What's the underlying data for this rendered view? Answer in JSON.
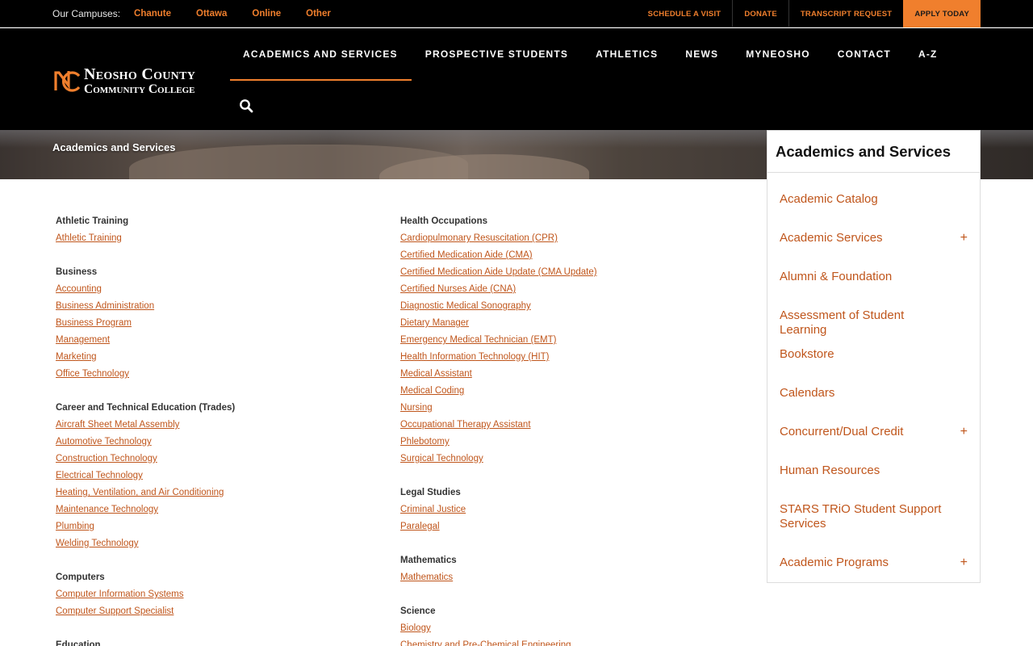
{
  "topbar": {
    "campuses_label": "Our Campuses:",
    "campuses": [
      "Chanute",
      "Ottawa",
      "Online",
      "Other"
    ],
    "utility_links": [
      "SCHEDULE A VISIT",
      "DONATE",
      "TRANSCRIPT REQUEST"
    ],
    "apply_label": "APPLY TODAY"
  },
  "logo": {
    "line1": "Neosho County",
    "line2": "Community College"
  },
  "nav": {
    "items": [
      "ACADEMICS AND SERVICES",
      "PROSPECTIVE STUDENTS",
      "ATHLETICS",
      "NEWS",
      "MYNEOSHO",
      "CONTACT",
      "A-Z"
    ],
    "active_index": 0,
    "search_icon": "search-icon"
  },
  "hero": {
    "title": "Academics and Services"
  },
  "columns": [
    [
      {
        "heading": "Athletic Training",
        "links": [
          "Athletic Training"
        ]
      },
      {
        "heading": "Business",
        "links": [
          "Accounting",
          "Business Administration",
          "Business Program",
          "Management",
          "Marketing",
          "Office Technology"
        ]
      },
      {
        "heading": "Career and Technical Education (Trades)",
        "links": [
          "Aircraft Sheet Metal Assembly",
          "Automotive Technology",
          "Construction Technology",
          "Electrical Technology",
          "Heating, Ventilation, and Air Conditioning",
          "Maintenance Technology",
          "Plumbing",
          "Welding Technology"
        ]
      },
      {
        "heading": "Computers",
        "links": [
          "Computer Information Systems",
          "Computer Support Specialist"
        ]
      },
      {
        "heading": "Education",
        "links": []
      }
    ],
    [
      {
        "heading": "Health Occupations",
        "links": [
          "Cardiopulmonary Resuscitation (CPR)",
          "Certified Medication Aide (CMA)",
          "Certified Medication Aide Update (CMA Update)",
          "Certified Nurses Aide (CNA)",
          "Diagnostic Medical Sonography",
          "Dietary Manager",
          "Emergency Medical Technician (EMT)",
          "Health Information Technology (HIT)",
          "Medical Assistant",
          "Medical Coding",
          "Nursing",
          "Occupational Therapy Assistant",
          "Phlebotomy",
          "Surgical Technology"
        ]
      },
      {
        "heading": "Legal Studies",
        "links": [
          "Criminal Justice",
          "Paralegal"
        ]
      },
      {
        "heading": "Mathematics",
        "links": [
          "Mathematics"
        ]
      },
      {
        "heading": "Science",
        "links": [
          "Biology",
          "Chemistry and Pre-Chemical Engineering"
        ]
      }
    ]
  ],
  "sidebar": {
    "title": "Academics and Services",
    "items": [
      {
        "label": "Academic Catalog",
        "expandable": false
      },
      {
        "label": "Academic Services",
        "expandable": true
      },
      {
        "label": "Alumni & Foundation",
        "expandable": false
      },
      {
        "label": "Assessment of Student Learning",
        "expandable": false
      },
      {
        "label": "Bookstore",
        "expandable": false
      },
      {
        "label": "Calendars",
        "expandable": false
      },
      {
        "label": "Concurrent/Dual Credit",
        "expandable": true
      },
      {
        "label": "Human Resources",
        "expandable": false
      },
      {
        "label": "STARS TRiO Student Support Services",
        "expandable": false
      },
      {
        "label": "Academic Programs",
        "expandable": true
      }
    ],
    "expand_symbol": "+"
  },
  "colors": {
    "accent": "#f07f2d",
    "link": "#c0561c",
    "header_bg": "#000000"
  }
}
